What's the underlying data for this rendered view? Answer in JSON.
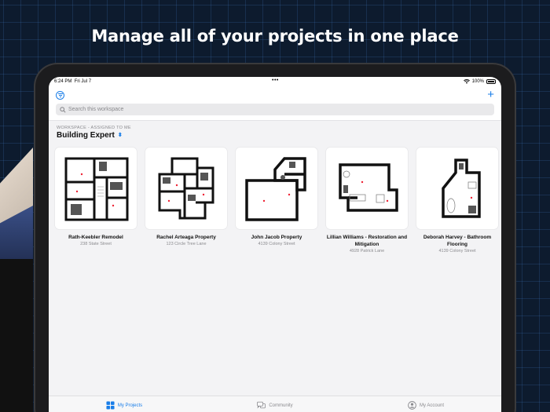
{
  "headline": "Manage all of your projects in one place",
  "status_bar": {
    "time": "6:24 PM",
    "date": "Fri Jul 7",
    "battery": "100%"
  },
  "search": {
    "placeholder": "Search this workspace"
  },
  "workspace": {
    "label": "WORKSPACE - ASSIGNED TO ME",
    "title": "Building Expert"
  },
  "projects": [
    {
      "title": "Rath-Keebler Remodel",
      "address": "238 State Street"
    },
    {
      "title": "Rachel Arteaga Property",
      "address": "123 Circle Tree Lane"
    },
    {
      "title": "John Jacob Property",
      "address": "4139 Colony Street"
    },
    {
      "title": "Lillian Williams - Restoration and Mitigation",
      "address": "4928 Patrick Lane"
    },
    {
      "title": "Deborah Harvey - Bathroom Flooring",
      "address": "4139 Colony Street"
    }
  ],
  "tabs": [
    {
      "label": "My Projects",
      "active": true
    },
    {
      "label": "Community",
      "active": false
    },
    {
      "label": "My Account",
      "active": false
    }
  ],
  "colors": {
    "accent": "#1a7ee8",
    "background": "#0d1b2e"
  }
}
